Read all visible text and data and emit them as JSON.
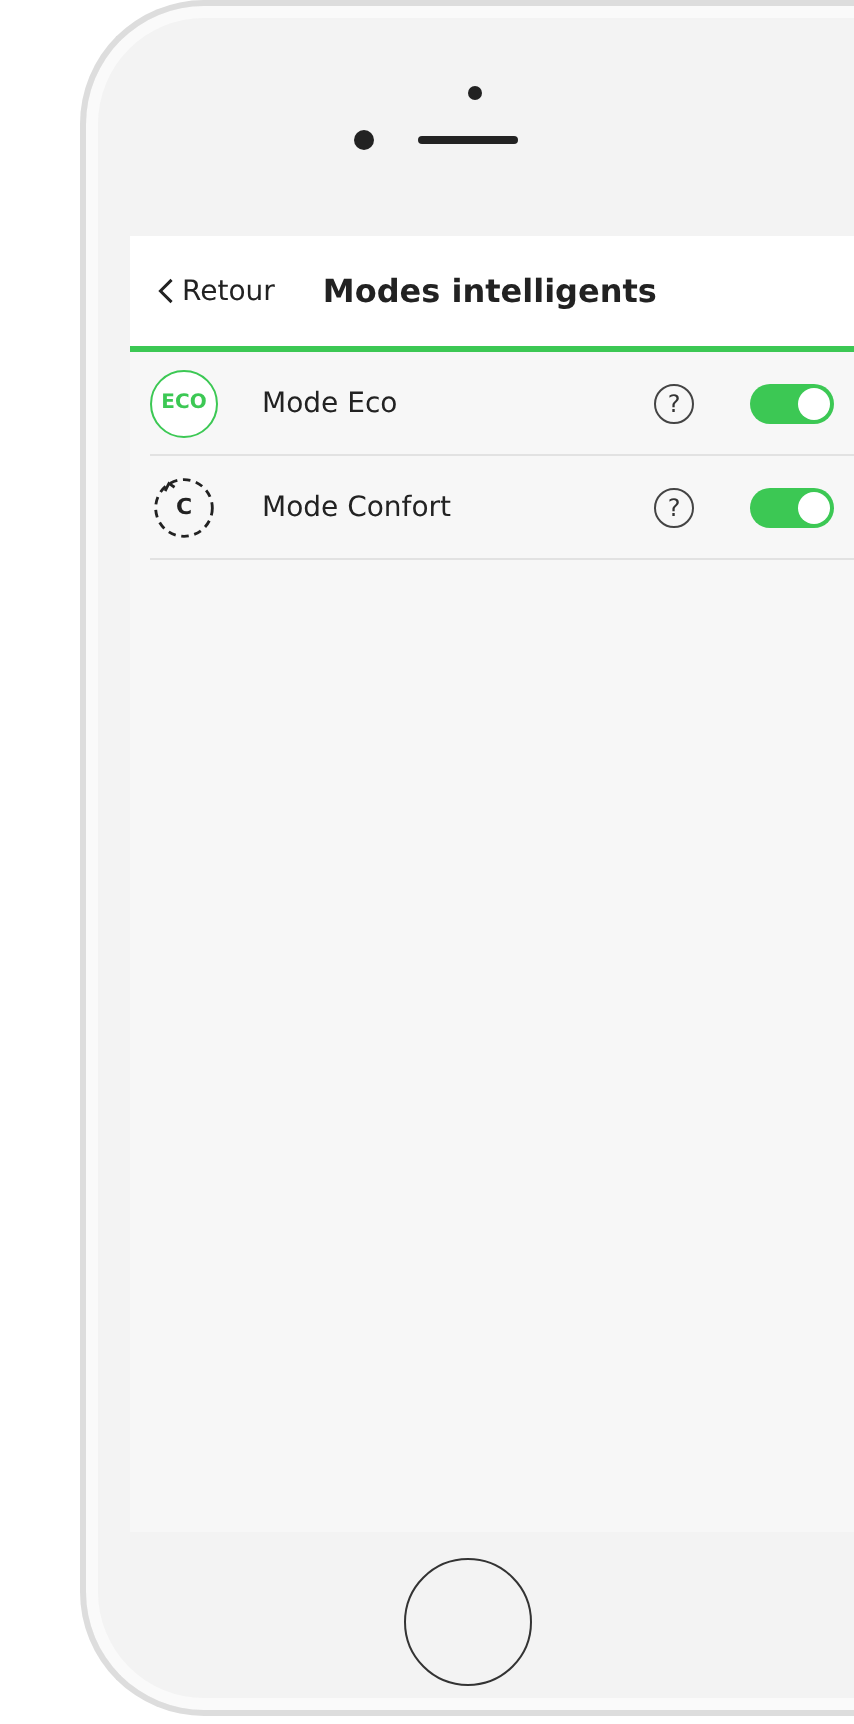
{
  "header": {
    "back_label": "Retour",
    "title": "Modes intelligents"
  },
  "modes": [
    {
      "kind": "eco",
      "icon_text": "ECO",
      "label": "Mode Eco",
      "help": "?",
      "on": true
    },
    {
      "kind": "comfort",
      "icon_text": "C",
      "label": "Mode Confort",
      "help": "?",
      "on": true
    }
  ]
}
